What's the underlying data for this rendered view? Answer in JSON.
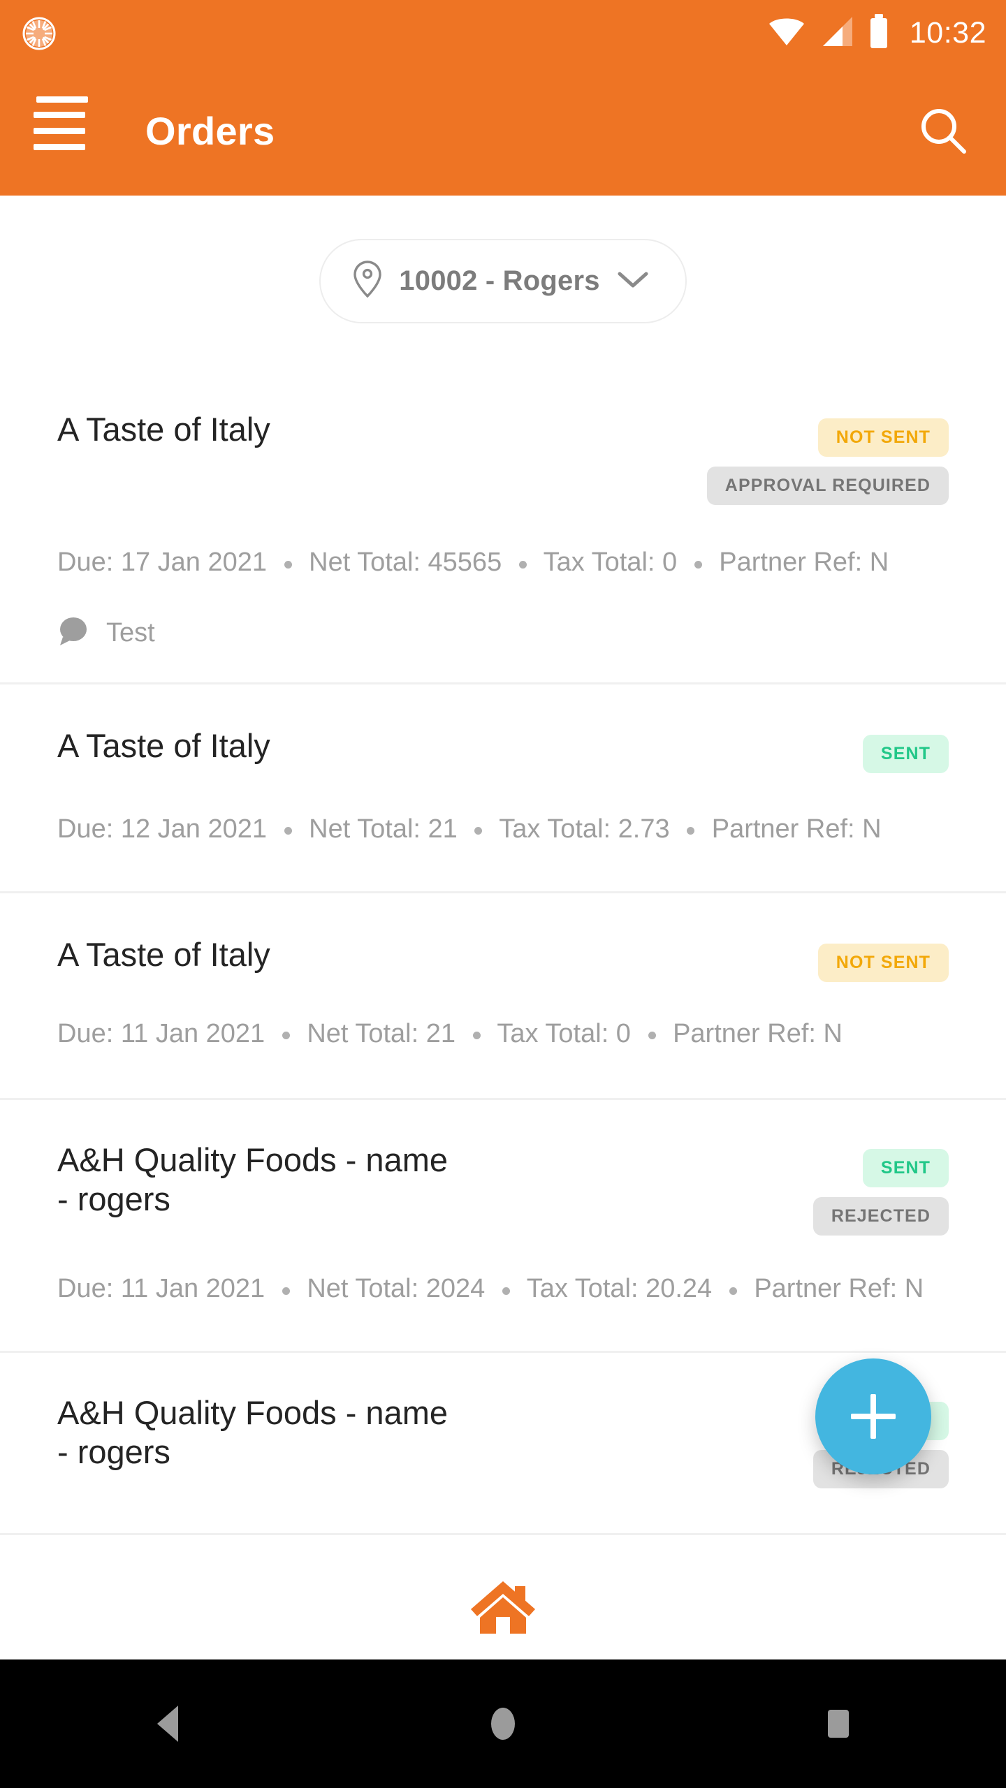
{
  "status_bar": {
    "time": "10:32",
    "icons": [
      "sync-icon",
      "wifi-icon",
      "cellular-signal-icon",
      "battery-icon"
    ]
  },
  "app_bar": {
    "title": "Orders",
    "menu_icon": "hamburger-menu-icon",
    "menu_has_notification": true,
    "search_icon": "search-icon",
    "background_color": "#EE7424"
  },
  "location_selector": {
    "pin_icon": "map-pin-icon",
    "label": "10002 - Rogers",
    "chevron_icon": "chevron-down-icon"
  },
  "orders": [
    {
      "title": "A Taste of Italy",
      "badges": [
        {
          "label": "NOT SENT",
          "style": "notsent"
        },
        {
          "label": "APPROVAL REQUIRED",
          "style": "grey"
        }
      ],
      "meta": {
        "due_label": "Due: 17 Jan 2021",
        "net_label": "Net Total: 45565",
        "tax_label": "Tax Total: 0",
        "partner_label": "Partner Ref: N"
      },
      "comment": {
        "icon": "comment-bubble-icon",
        "text": "Test"
      }
    },
    {
      "title": "A Taste of Italy",
      "badges": [
        {
          "label": "SENT",
          "style": "sent"
        }
      ],
      "meta": {
        "due_label": "Due: 12 Jan 2021",
        "net_label": "Net Total: 21",
        "tax_label": "Tax Total: 2.73",
        "partner_label": "Partner Ref: N"
      }
    },
    {
      "title": "A Taste of Italy",
      "badges": [
        {
          "label": "NOT SENT",
          "style": "notsent"
        }
      ],
      "meta": {
        "due_label": "Due: 11 Jan 2021",
        "net_label": "Net Total: 21",
        "tax_label": "Tax Total: 0",
        "partner_label": "Partner Ref: N"
      }
    },
    {
      "title": "A&H Quality Foods - name - rogers",
      "badges": [
        {
          "label": "SENT",
          "style": "sent"
        },
        {
          "label": "REJECTED",
          "style": "grey"
        }
      ],
      "meta": {
        "due_label": "Due: 11 Jan 2021",
        "net_label": "Net Total: 2024",
        "tax_label": "Tax Total: 20.24",
        "partner_label": "Partner Ref: N"
      }
    },
    {
      "title": "A&H Quality Foods - name - rogers",
      "badges": [
        {
          "label": "SENT",
          "style": "sent"
        },
        {
          "label": "REJECTED",
          "style": "grey"
        }
      ]
    }
  ],
  "fab": {
    "icon": "plus-icon",
    "color": "#43B6E0"
  },
  "bottom_bar": {
    "home_icon": "home-icon",
    "color": "#EE7424"
  },
  "android_nav": {
    "back": "back-triangle-icon",
    "home": "home-circle-icon",
    "recents": "recents-square-icon"
  }
}
